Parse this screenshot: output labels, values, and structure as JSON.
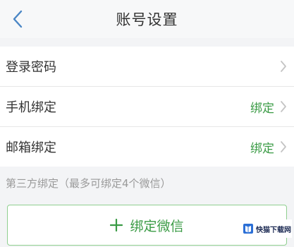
{
  "header": {
    "title": "账号设置",
    "back_icon": "chevron-left-icon"
  },
  "rows": [
    {
      "label": "登录密码",
      "status": ""
    },
    {
      "label": "手机绑定",
      "status": "绑定"
    },
    {
      "label": "邮箱绑定",
      "status": "绑定"
    }
  ],
  "third_party": {
    "section_label": "第三方绑定（最多可绑定4个微信）",
    "button_label": "绑定微信",
    "button_icon": "plus-icon"
  },
  "watermark": {
    "text": "快猫下载网"
  },
  "colors": {
    "accent_green": "#3a9b45",
    "back_blue": "#4a86c5"
  }
}
